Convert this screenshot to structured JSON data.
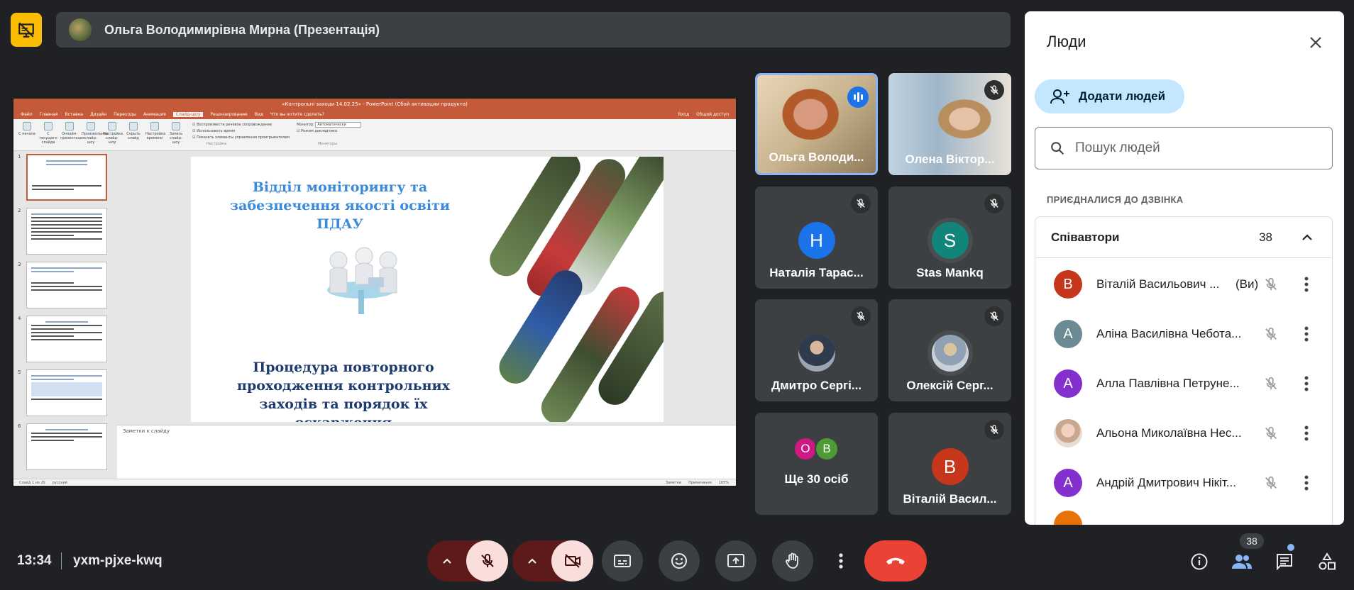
{
  "presentation": {
    "title": "Ольга Володимирівна Мирна (Презентація)"
  },
  "ppt": {
    "window_title": "«Контрольні заходи 14.02.25» - PowerPoint (Сбой активации продукта)",
    "tabs": [
      "Файл",
      "Главная",
      "Вставка",
      "Дизайн",
      "Переходы",
      "Анимация",
      "Слайд-шоу",
      "Рецензирование",
      "Вид"
    ],
    "active_tab": "Слайд-шоу",
    "tell_me": "Что вы хотите сделать?",
    "sign_in": "Вход",
    "share": "Общий доступ",
    "ribbon_buttons": [
      "С начала",
      "С текущего слайда",
      "Онлайн-презентация",
      "Произвольное слайд-шоу",
      "Настройка слайд-шоу",
      "Скрыть слайд",
      "Настройка времени",
      "Запись слайд-шоу"
    ],
    "ribbon_checks": [
      "Воспроизвести речевое сопровождение",
      "Использовать время",
      "Показать элементы управления проигрывателем"
    ],
    "monitor_label": "Монитор:",
    "monitor_value": "Автоматически",
    "presenter_view": "Режим докладчика",
    "group_labels": [
      "Начать слайд-шоу",
      "Настройка",
      "Мониторы"
    ],
    "thumb_numbers": [
      "1",
      "2",
      "3",
      "4",
      "5",
      "6"
    ],
    "slide_heading": "Відділ моніторингу та забезпечення якості освіти ПДАУ",
    "slide_subheading": "Процедура повторного проходження контрольних заходів та порядок їх оскарження",
    "notes_placeholder": "Заметки к слайду",
    "status_slide": "Слайд 1 из 20",
    "status_lang": "русский",
    "status_notes": "Заметки",
    "status_comments": "Примечания",
    "zoom": "105%"
  },
  "tiles": [
    {
      "name": "Ольга Володи...",
      "speaking": true
    },
    {
      "name": "Олена Віктор...",
      "muted": true
    },
    {
      "name": "Наталія Тарас...",
      "initial": "Н",
      "color": "#1a73e8",
      "muted": true
    },
    {
      "name": "Stas Mankq",
      "initial": "S",
      "color": "#12857b",
      "muted": true
    },
    {
      "name": "Дмитро Сергі...",
      "muted": true
    },
    {
      "name": "Олексій Серг...",
      "muted": true
    },
    {
      "name": "Ще 30 осіб",
      "initials": [
        "О",
        "В"
      ]
    },
    {
      "name": "Віталій Васил...",
      "initial": "В",
      "color": "#c5361b",
      "muted": true
    }
  ],
  "people_panel": {
    "title": "Люди",
    "add_button": "Додати людей",
    "search_placeholder": "Пошук людей",
    "section_label": "ПРИЄДНАЛИСЯ ДО ДЗВІНКА",
    "group_name": "Співавтори",
    "group_count": "38",
    "people": [
      {
        "initial": "В",
        "name": "Віталій Васильович ...",
        "you": "(Ви)",
        "color": "#c5361b"
      },
      {
        "initial": "А",
        "name": "Аліна Василівна Чебота...",
        "color": "#6c8a94"
      },
      {
        "initial": "А",
        "name": "Алла Павлівна Петруне...",
        "color": "#8430ce"
      },
      {
        "initial": "",
        "name": "Альона Миколаївна Нес...",
        "color": "#d9b8a8"
      },
      {
        "initial": "А",
        "name": "Андрій Дмитрович Нікіт...",
        "color": "#8430ce"
      }
    ]
  },
  "bottom": {
    "time": "13:34",
    "meeting_code": "yxm-pjxe-kwq",
    "participants_badge": "38"
  }
}
